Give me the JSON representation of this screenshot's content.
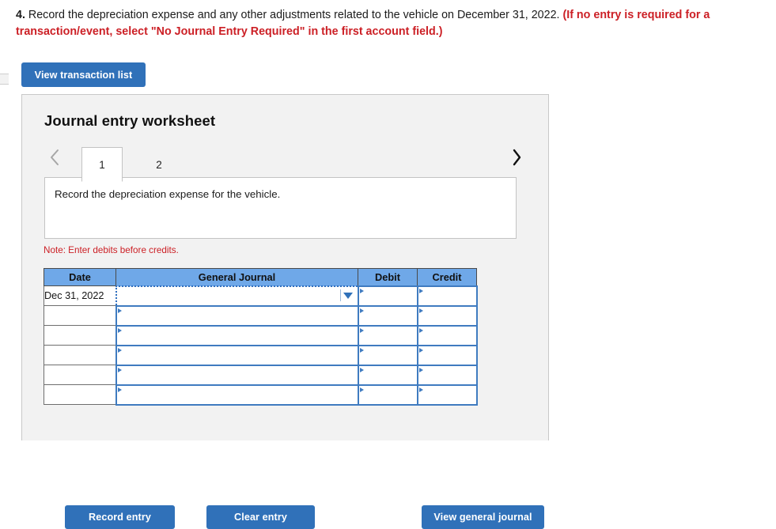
{
  "question": {
    "number": "4.",
    "body": " Record the depreciation expense and any other adjustments related to the vehicle on December 31, 2022. ",
    "red_note": "(If no entry is required for a transaction/event, select \"No Journal Entry Required\" in the first account field.)"
  },
  "toolbar": {
    "view_transaction_list": "View transaction list"
  },
  "panel": {
    "title": "Journal entry worksheet",
    "nav": {
      "prev_icon": "chevron-left-icon",
      "prev_glyph": "‹",
      "next_icon": "chevron-right-icon",
      "next_glyph": "›"
    },
    "tabs": [
      {
        "label": "1",
        "active": true
      },
      {
        "label": "2",
        "active": false
      }
    ],
    "instruction": "Record the depreciation expense for the vehicle.",
    "note": "Note: Enter debits before credits."
  },
  "table": {
    "headers": [
      "Date",
      "General Journal",
      "Debit",
      "Credit"
    ],
    "rows": [
      {
        "date": "Dec 31, 2022",
        "general_journal": "",
        "debit": "",
        "credit": "",
        "selected": true
      },
      {
        "date": "",
        "general_journal": "",
        "debit": "",
        "credit": "",
        "selected": false
      },
      {
        "date": "",
        "general_journal": "",
        "debit": "",
        "credit": "",
        "selected": false
      },
      {
        "date": "",
        "general_journal": "",
        "debit": "",
        "credit": "",
        "selected": false
      },
      {
        "date": "",
        "general_journal": "",
        "debit": "",
        "credit": "",
        "selected": false
      },
      {
        "date": "",
        "general_journal": "",
        "debit": "",
        "credit": "",
        "selected": false
      }
    ]
  },
  "footer": {
    "record_entry": "Record entry",
    "clear_entry": "Clear entry",
    "view_general_journal": "View general journal"
  },
  "colors": {
    "button_blue": "#3071b9",
    "header_blue": "#6fa8e8",
    "cell_border_blue": "#3f7bc0",
    "alert_red": "#cc2026",
    "panel_gray": "#f2f2f2"
  }
}
